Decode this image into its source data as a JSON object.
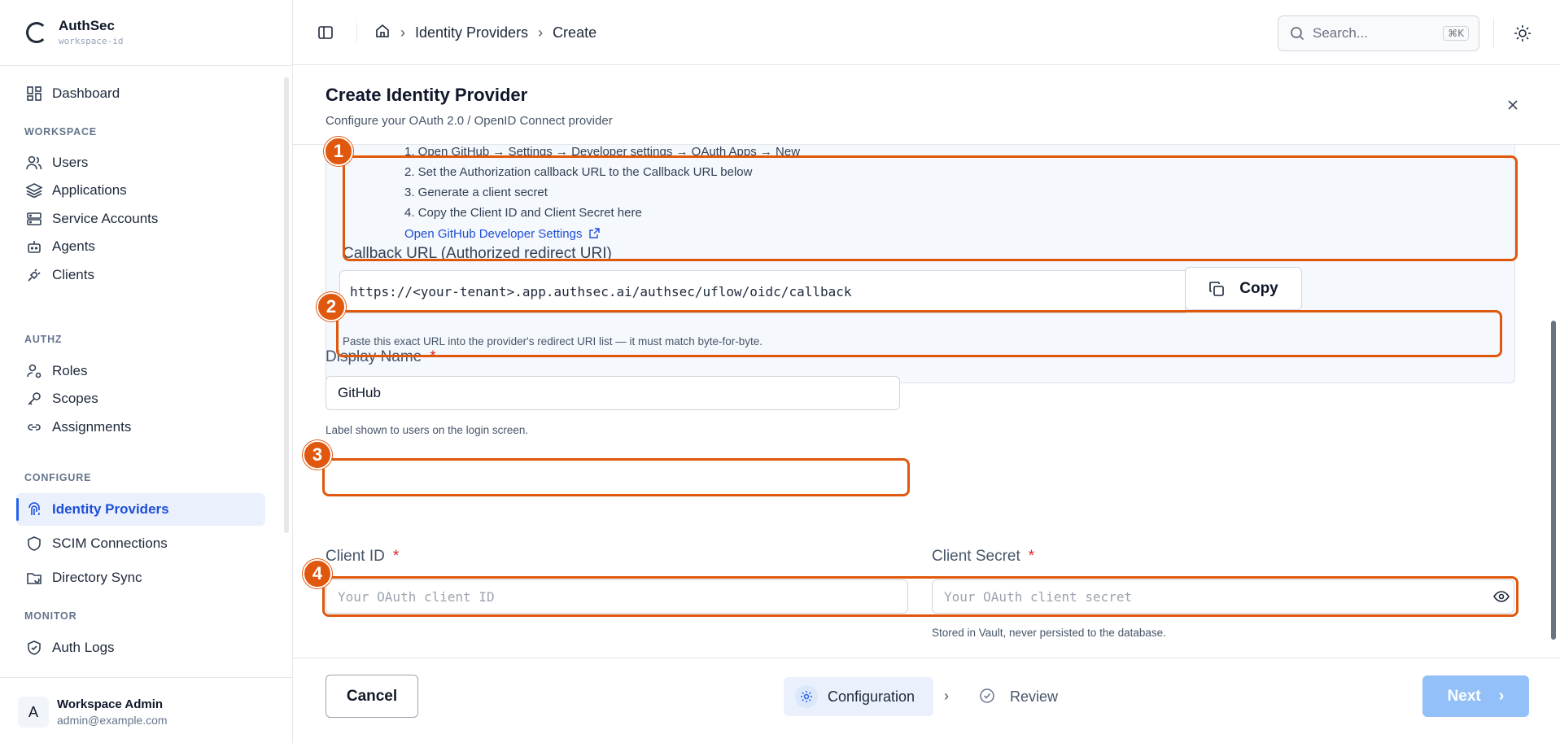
{
  "brand": {
    "name": "AuthSec",
    "workspace": "workspace-id"
  },
  "nav": {
    "dashboard": "Dashboard",
    "sections": {
      "workspace": "WORKSPACE",
      "authz": "AUTHZ",
      "configure": "CONFIGURE",
      "monitor": "MONITOR"
    },
    "items": {
      "users": "Users",
      "applications": "Applications",
      "service_accounts": "Service Accounts",
      "agents": "Agents",
      "clients": "Clients",
      "roles": "Roles",
      "scopes": "Scopes",
      "assignments": "Assignments",
      "identity_providers": "Identity Providers",
      "scim": "SCIM Connections",
      "directory_sync": "Directory Sync",
      "auth_logs": "Auth Logs"
    },
    "active": "identity_providers"
  },
  "user": {
    "initial": "A",
    "name": "Workspace Admin",
    "email": "admin@example.com"
  },
  "breadcrumb": {
    "section": "Identity Providers",
    "page": "Create"
  },
  "search": {
    "placeholder": "Search...",
    "shortcut": "⌘K"
  },
  "dialog": {
    "title": "Create Identity Provider",
    "subtitle": "Configure your OAuth 2.0 / OpenID Connect provider"
  },
  "setup": {
    "steps": [
      "1. Open GitHub → Settings → Developer settings → OAuth Apps → New",
      "2. Set the Authorization callback URL to the Callback URL below",
      "3. Generate a client secret",
      "4. Copy the Client ID and Client Secret here"
    ],
    "link": "Open GitHub Developer Settings"
  },
  "callback": {
    "label": "Callback URL (Authorized redirect URI)",
    "value": "https://<your-tenant>.app.authsec.ai/authsec/uflow/oidc/callback",
    "copy_label": "Copy",
    "help": "Paste this exact URL into the provider's redirect URI list — it must match byte-for-byte."
  },
  "display_name": {
    "label": "Display Name",
    "required": "*",
    "value": "GitHub",
    "help": "Label shown to users on the login screen."
  },
  "client_id": {
    "label": "Client ID",
    "required": "*",
    "placeholder": "Your OAuth client ID"
  },
  "client_secret": {
    "label": "Client Secret",
    "required": "*",
    "placeholder": "Your OAuth client secret",
    "help": "Stored in Vault, never persisted to the database."
  },
  "footer": {
    "cancel": "Cancel",
    "step1": "Configuration",
    "step2": "Review",
    "next": "Next"
  },
  "annotations": [
    "1",
    "2",
    "3",
    "4"
  ],
  "colors": {
    "accent": "#2563eb",
    "annotation": "#e0580e",
    "next_disabled": "#93c0f8",
    "required": "#dc2626"
  }
}
